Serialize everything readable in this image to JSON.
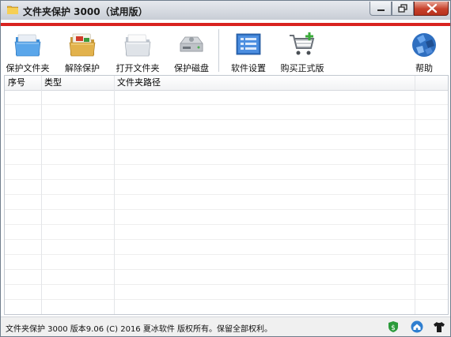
{
  "window": {
    "title": "文件夹保护 3000（试用版）",
    "icon": "folder-lock-icon"
  },
  "title_buttons": {
    "minimize": "minimize-icon",
    "maximize": "restore-icon",
    "close": "close-icon"
  },
  "toolbar": {
    "items": [
      {
        "label": "保护文件夹",
        "icon": "protect-folder-icon"
      },
      {
        "label": "解除保护",
        "icon": "unprotect-folder-icon"
      },
      {
        "label": "打开文件夹",
        "icon": "open-folder-icon"
      },
      {
        "label": "保护磁盘",
        "icon": "protect-disk-icon"
      },
      {
        "label": "软件设置",
        "icon": "settings-icon"
      },
      {
        "label": "购买正式版",
        "icon": "shopping-cart-icon"
      },
      {
        "label": "帮助",
        "icon": "help-icon"
      }
    ]
  },
  "table": {
    "columns": [
      "序号",
      "类型",
      "文件夹路径"
    ],
    "rows": []
  },
  "status": {
    "text": "文件夹保护 3000 版本9.06 (C) 2016 夏冰软件 版权所有。保留全部权利。",
    "icons": [
      "shield-icon",
      "home-icon",
      "shirt-icon"
    ]
  },
  "colors": {
    "accent_red": "#d9221f",
    "close_button": "#c7412b",
    "status_shield": "#2a9a3a",
    "status_home": "#2f7fd0"
  }
}
